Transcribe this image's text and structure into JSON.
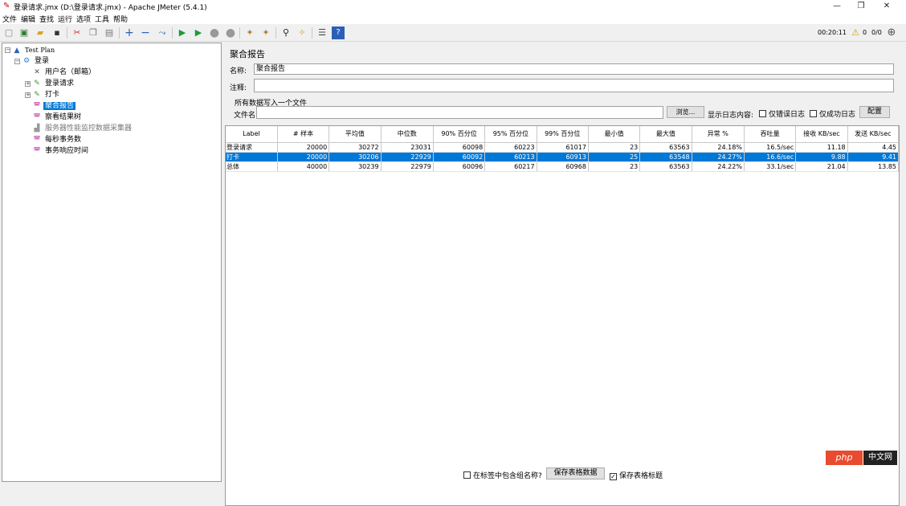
{
  "window": {
    "title": "登录请求.jmx (D:\\登录请求.jmx) - Apache JMeter (5.4.1)",
    "minimize": "—",
    "restore": "❐",
    "close": "✕"
  },
  "menu": [
    "文件",
    "编辑",
    "查找",
    "运行",
    "选项",
    "工具",
    "帮助"
  ],
  "toolbar": {
    "icons": [
      "new-icon",
      "templates-icon",
      "open-icon",
      "save-icon",
      "cut-icon",
      "copy-icon",
      "paste-icon",
      "expand-icon",
      "collapse-icon",
      "toggle-icon",
      "start-icon",
      "start-no-pause-icon",
      "stop-icon",
      "shutdown-icon",
      "clear-icon",
      "clear-all-icon",
      "search-icon",
      "reset-search-icon",
      "function-helper-icon",
      "help-icon"
    ],
    "elapsed": "00:20:11",
    "warnings": "0",
    "threads": "0/0"
  },
  "tree": [
    {
      "label": "Test Plan",
      "icon": "test-plan-icon",
      "selected": false,
      "disabled": false
    },
    {
      "label": "登录",
      "icon": "thread-group-icon",
      "selected": false,
      "disabled": false
    },
    {
      "label": "用户名（邮箱）",
      "icon": "config-element-icon",
      "selected": false,
      "disabled": false
    },
    {
      "label": "登录请求",
      "icon": "sampler-icon",
      "selected": false,
      "disabled": false
    },
    {
      "label": "打卡",
      "icon": "sampler-icon",
      "selected": false,
      "disabled": false
    },
    {
      "label": "聚合报告",
      "icon": "listener-icon",
      "selected": true,
      "disabled": false
    },
    {
      "label": "察看结果树",
      "icon": "listener-icon",
      "selected": false,
      "disabled": false
    },
    {
      "label": "服务器性能监控数据采集器",
      "icon": "listener-icon",
      "selected": false,
      "disabled": true
    },
    {
      "label": "每秒事务数",
      "icon": "listener-icon",
      "selected": false,
      "disabled": false
    },
    {
      "label": "事务响应时间",
      "icon": "listener-icon",
      "selected": false,
      "disabled": false
    }
  ],
  "panel": {
    "title": "聚合报告",
    "name_label": "名称:",
    "name_value": "聚合报告",
    "comment_label": "注释:",
    "comment_value": "",
    "write_all_label": "所有数据写入一个文件",
    "filename_label": "文件名",
    "filename_value": "",
    "browse_button": "浏览...",
    "log_contents_label": "显示日志内容:",
    "errors_only_label": "仅错误日志",
    "success_only_label": "仅成功日志",
    "configure_button": "配置"
  },
  "table": {
    "columns": [
      "Label",
      "# 样本",
      "平均值",
      "中位数",
      "90% 百分位",
      "95% 百分位",
      "99% 百分位",
      "最小值",
      "最大值",
      "异常 %",
      "吞吐量",
      "接收 KB/sec",
      "发送 KB/sec"
    ],
    "rows": [
      [
        "登录请求",
        "20000",
        "30272",
        "23031",
        "60098",
        "60223",
        "61017",
        "23",
        "63563",
        "24.18%",
        "16.5/sec",
        "11.18",
        "4.45"
      ],
      [
        "打卡",
        "20000",
        "30206",
        "22929",
        "60092",
        "60213",
        "60913",
        "25",
        "63548",
        "24.27%",
        "16.6/sec",
        "9.88",
        "9.41"
      ],
      [
        "总体",
        "40000",
        "30239",
        "22979",
        "60096",
        "60217",
        "60968",
        "23",
        "63563",
        "24.22%",
        "33.1/sec",
        "21.04",
        "13.85"
      ]
    ],
    "selected_row": 1
  },
  "bottom": {
    "include_group_label": "在标签中包含组名称?",
    "save_table_button": "保存表格数据",
    "save_header_label": "保存表格标题",
    "save_header_checked": "✓"
  },
  "watermark": {
    "badge_left": "php",
    "badge_right": "中文网"
  }
}
